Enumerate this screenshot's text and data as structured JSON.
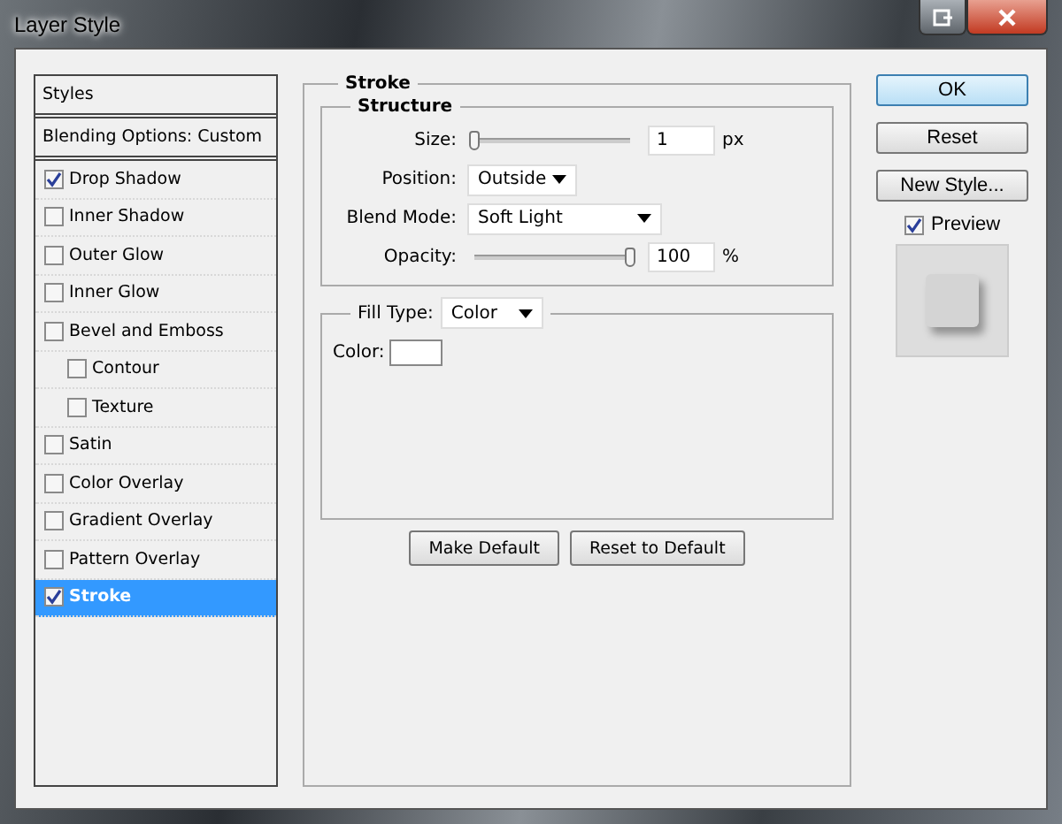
{
  "window": {
    "title": "Layer Style"
  },
  "sidebar": {
    "items": [
      {
        "kind": "header",
        "label": "Styles",
        "selected": false
      },
      {
        "kind": "header",
        "label": "Blending Options: Custom",
        "selected": false
      },
      {
        "kind": "check",
        "label": "Drop Shadow",
        "checked": true,
        "selected": false
      },
      {
        "kind": "check",
        "label": "Inner Shadow",
        "checked": false,
        "selected": false
      },
      {
        "kind": "check",
        "label": "Outer Glow",
        "checked": false,
        "selected": false
      },
      {
        "kind": "check",
        "label": "Inner Glow",
        "checked": false,
        "selected": false
      },
      {
        "kind": "check",
        "label": "Bevel and Emboss",
        "checked": false,
        "selected": false,
        "children": [
          {
            "kind": "check",
            "label": "Contour",
            "checked": false,
            "selected": false
          },
          {
            "kind": "check",
            "label": "Texture",
            "checked": false,
            "selected": false
          }
        ]
      },
      {
        "kind": "check",
        "label": "Satin",
        "checked": false,
        "selected": false
      },
      {
        "kind": "check",
        "label": "Color Overlay",
        "checked": false,
        "selected": false
      },
      {
        "kind": "check",
        "label": "Gradient Overlay",
        "checked": false,
        "selected": false
      },
      {
        "kind": "check",
        "label": "Pattern Overlay",
        "checked": false,
        "selected": false
      },
      {
        "kind": "check",
        "label": "Stroke",
        "checked": true,
        "selected": true
      }
    ]
  },
  "stroke": {
    "title": "Stroke",
    "structure": {
      "title": "Structure",
      "size": {
        "label": "Size:",
        "level": 0.0,
        "value": "1",
        "unit": "px"
      },
      "position": {
        "label": "Position:",
        "value": "Outside"
      },
      "blend_mode": {
        "label": "Blend Mode:",
        "value": "Soft Light"
      },
      "opacity": {
        "label": "Opacity:",
        "level": 1.0,
        "value": "100",
        "unit": "%"
      }
    },
    "fill": {
      "label": "Fill Type:",
      "value": "Color",
      "color_label": "Color:",
      "color": "#ffffff"
    },
    "buttons": [
      "Make Default",
      "Reset to Default"
    ]
  },
  "actions": {
    "buttons": [
      {
        "label": "OK",
        "default": true
      },
      {
        "label": "Reset",
        "default": false
      },
      {
        "label": "New Style...",
        "default": false
      }
    ],
    "preview": {
      "label": "Preview",
      "checked": true
    }
  }
}
